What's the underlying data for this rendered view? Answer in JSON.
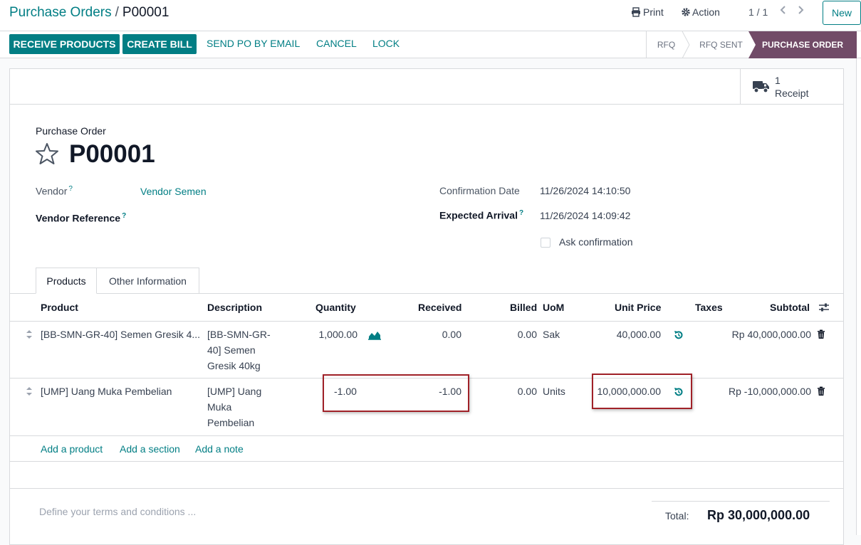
{
  "breadcrumb": {
    "parent": "Purchase Orders",
    "separator": "/",
    "current": "P00001"
  },
  "top_actions": {
    "print": "Print",
    "action": "Action",
    "pager": "1 / 1",
    "new": "New"
  },
  "status_buttons": {
    "receive": "RECEIVE PRODUCTS",
    "create_bill": "CREATE BILL",
    "send_email": "SEND PO BY EMAIL",
    "cancel": "CANCEL",
    "lock": "LOCK"
  },
  "stages": [
    {
      "label": "RFQ",
      "active": false
    },
    {
      "label": "RFQ SENT",
      "active": false
    },
    {
      "label": "PURCHASE ORDER",
      "active": true
    }
  ],
  "smart_button": {
    "count": "1",
    "label": "Receipt",
    "icon": "truck-icon"
  },
  "form": {
    "title_label": "Purchase Order",
    "name": "P00001",
    "vendor_label": "Vendor",
    "vendor_value": "Vendor Semen",
    "vendor_ref_label": "Vendor Reference",
    "confirmation_label": "Confirmation Date",
    "confirmation_value": "11/26/2024 14:10:50",
    "expected_label": "Expected Arrival",
    "expected_value": "11/26/2024 14:09:42",
    "ask_confirmation_label": "Ask confirmation",
    "help_mark": "?"
  },
  "tabs": [
    {
      "label": "Products",
      "active": true
    },
    {
      "label": "Other Information",
      "active": false
    }
  ],
  "table": {
    "headers": [
      "Product",
      "Description",
      "Quantity",
      "Received",
      "Billed",
      "UoM",
      "Unit Price",
      "Taxes",
      "Subtotal"
    ],
    "rows": [
      {
        "product": "[BB-SMN-GR-40] Semen Gresik 4...",
        "description_lines": [
          "[BB-SMN-GR-",
          "40] Semen",
          "Gresik 40kg"
        ],
        "quantity": "1,000.00",
        "received": "0.00",
        "billed": "0.00",
        "uom": "Sak",
        "unit_price": "40,000.00",
        "taxes": "",
        "subtotal": "Rp 40,000,000.00"
      },
      {
        "product": "[UMP] Uang Muka Pembelian",
        "description_lines": [
          "[UMP] Uang",
          "Muka",
          "Pembelian"
        ],
        "quantity": "-1.00",
        "received": "-1.00",
        "billed": "0.00",
        "uom": "Units",
        "unit_price": "10,000,000.00",
        "taxes": "",
        "subtotal": "Rp -10,000,000.00"
      }
    ],
    "add_links": [
      "Add a product",
      "Add a section",
      "Add a note"
    ]
  },
  "footer": {
    "terms_placeholder": "Define your terms and conditions ...",
    "total_label": "Total:",
    "total_value": "Rp 30,000,000.00"
  },
  "colors": {
    "brand": "#017e84",
    "stage_active": "#714b67",
    "highlight": "#a02128"
  }
}
